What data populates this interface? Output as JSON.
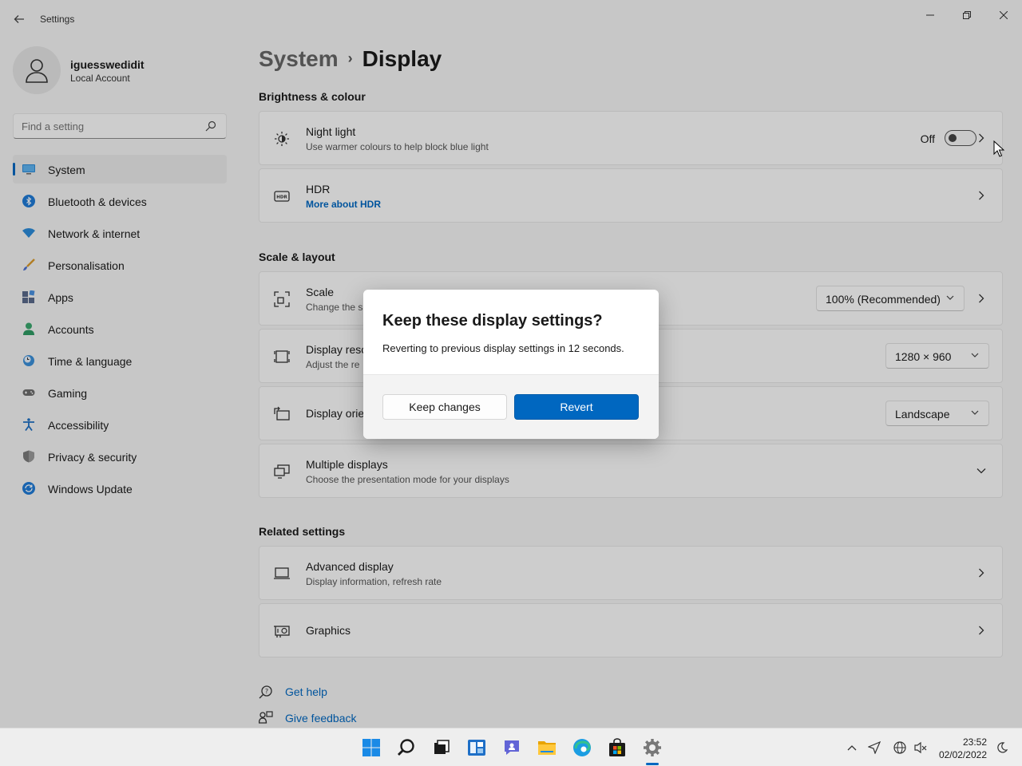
{
  "window": {
    "title": "Settings"
  },
  "user": {
    "name": "iguesswedidit",
    "account_type": "Local Account"
  },
  "search": {
    "placeholder": "Find a setting"
  },
  "sidebar": {
    "items": [
      {
        "label": "System",
        "icon": "monitor-icon",
        "active": true
      },
      {
        "label": "Bluetooth & devices",
        "icon": "bluetooth-icon"
      },
      {
        "label": "Network & internet",
        "icon": "wifi-icon"
      },
      {
        "label": "Personalisation",
        "icon": "brush-icon"
      },
      {
        "label": "Apps",
        "icon": "apps-icon"
      },
      {
        "label": "Accounts",
        "icon": "person-icon"
      },
      {
        "label": "Time & language",
        "icon": "clock-globe-icon"
      },
      {
        "label": "Gaming",
        "icon": "gamepad-icon"
      },
      {
        "label": "Accessibility",
        "icon": "accessibility-icon"
      },
      {
        "label": "Privacy & security",
        "icon": "shield-icon"
      },
      {
        "label": "Windows Update",
        "icon": "update-icon"
      }
    ]
  },
  "breadcrumb": {
    "parent": "System",
    "separator": "›",
    "current": "Display"
  },
  "sections": {
    "brightness": "Brightness & colour",
    "scale": "Scale & layout",
    "related": "Related settings"
  },
  "cards": {
    "night_light": {
      "title": "Night light",
      "subtitle": "Use warmer colours to help block blue light",
      "state": "Off"
    },
    "hdr": {
      "title": "HDR",
      "link": "More about HDR"
    },
    "scale": {
      "title": "Scale",
      "subtitle": "Change the s",
      "value": "100% (Recommended)"
    },
    "resolution": {
      "title": "Display resc",
      "subtitle": "Adjust the re",
      "value": "1280 × 960"
    },
    "orientation": {
      "title": "Display orie",
      "value": "Landscape"
    },
    "multiple": {
      "title": "Multiple displays",
      "subtitle": "Choose the presentation mode for your displays"
    },
    "advanced": {
      "title": "Advanced display",
      "subtitle": "Display information, refresh rate"
    },
    "graphics": {
      "title": "Graphics"
    }
  },
  "help": {
    "get_help": "Get help",
    "feedback": "Give feedback"
  },
  "dialog": {
    "title": "Keep these display settings?",
    "message": "Reverting to previous display settings in 12 seconds.",
    "countdown_seconds": 12,
    "keep_label": "Keep changes",
    "revert_label": "Revert"
  },
  "taskbar": {
    "time": "23:52",
    "date": "02/02/2022",
    "pinned": [
      "start-icon",
      "search-icon",
      "task-view-icon",
      "widgets-icon",
      "chat-icon",
      "file-explorer-icon",
      "edge-icon",
      "store-icon",
      "settings-icon"
    ]
  },
  "colors": {
    "accent": "#0067c0",
    "background": "#f3f3f3",
    "card": "#fbfbfb"
  }
}
